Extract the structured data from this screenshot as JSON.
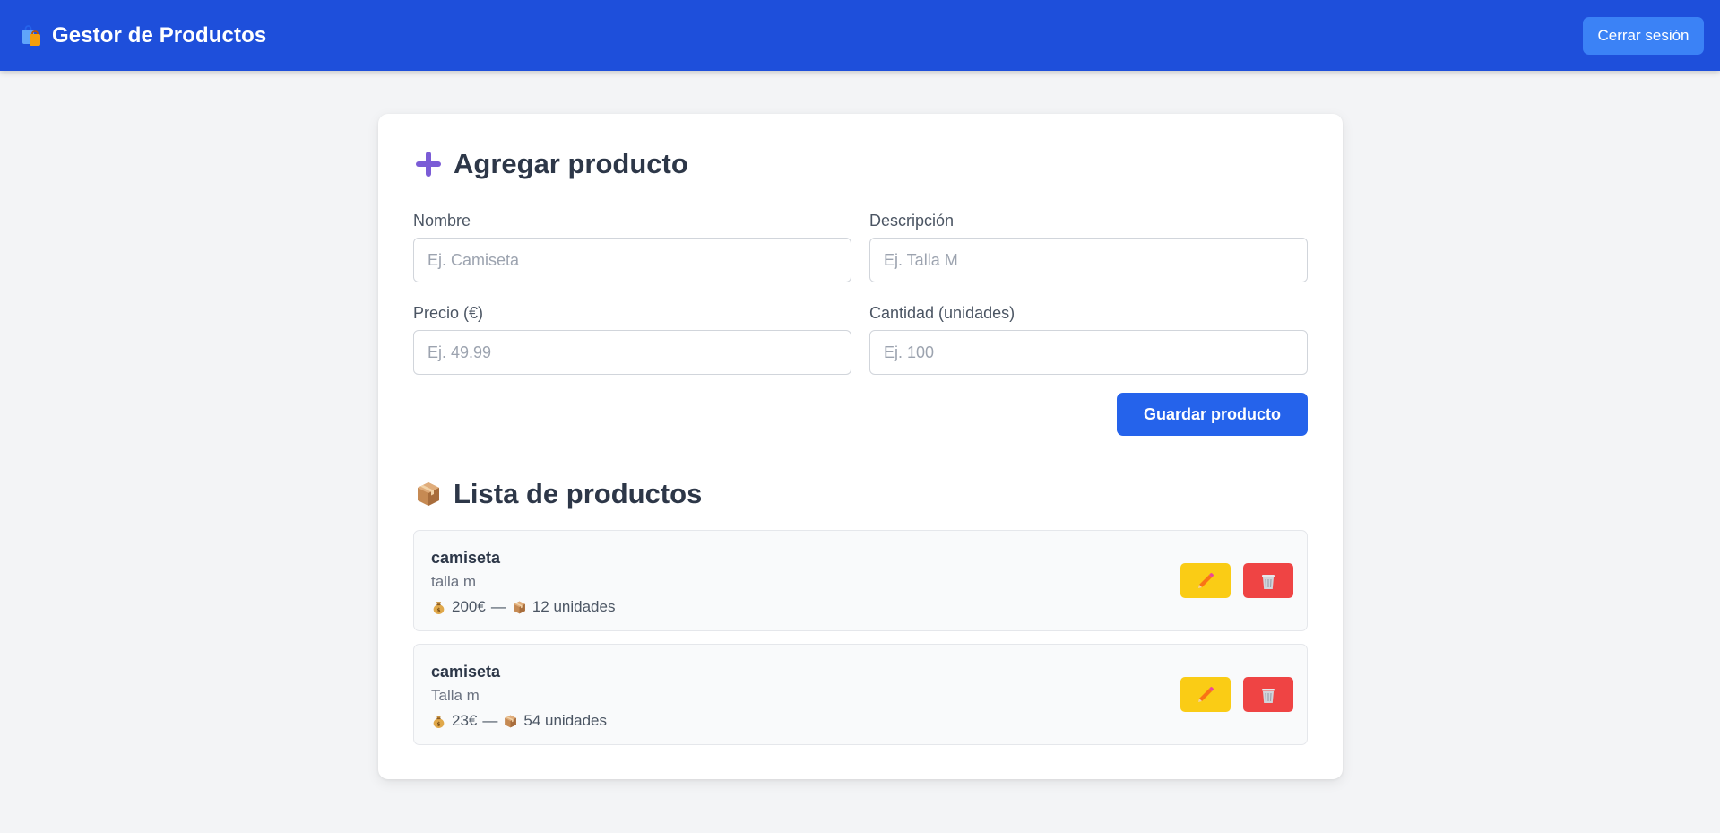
{
  "header": {
    "title": "Gestor de Productos",
    "logout_label": "Cerrar sesión"
  },
  "form": {
    "title": "Agregar producto",
    "fields": {
      "name": {
        "label": "Nombre",
        "placeholder": "Ej. Camiseta"
      },
      "description": {
        "label": "Descripción",
        "placeholder": "Ej. Talla M"
      },
      "price": {
        "label": "Precio (€)",
        "placeholder": "Ej. 49.99"
      },
      "quantity": {
        "label": "Cantidad (unidades)",
        "placeholder": "Ej. 100"
      }
    },
    "save_label": "Guardar producto"
  },
  "list": {
    "title": "Lista de productos",
    "separator": "—",
    "items": [
      {
        "name": "camiseta",
        "description": "talla m",
        "price": "200€",
        "quantity": "12 unidades"
      },
      {
        "name": "camiseta",
        "description": "Talla m",
        "price": "23€",
        "quantity": "54 unidades"
      }
    ]
  },
  "icons": {
    "brand": "shopping-bags-icon",
    "add": "plus-icon",
    "list": "package-icon",
    "price": "money-bag-icon",
    "quantity": "package-icon",
    "edit": "pencil-icon",
    "delete": "wastebasket-icon"
  },
  "colors": {
    "header_bg": "#1e4fdb",
    "logout_bg": "#3b82f6",
    "primary": "#2563eb",
    "edit": "#facc15",
    "delete": "#ef4444",
    "page_bg": "#f3f4f6",
    "accent_purple": "#7b5cd6"
  }
}
